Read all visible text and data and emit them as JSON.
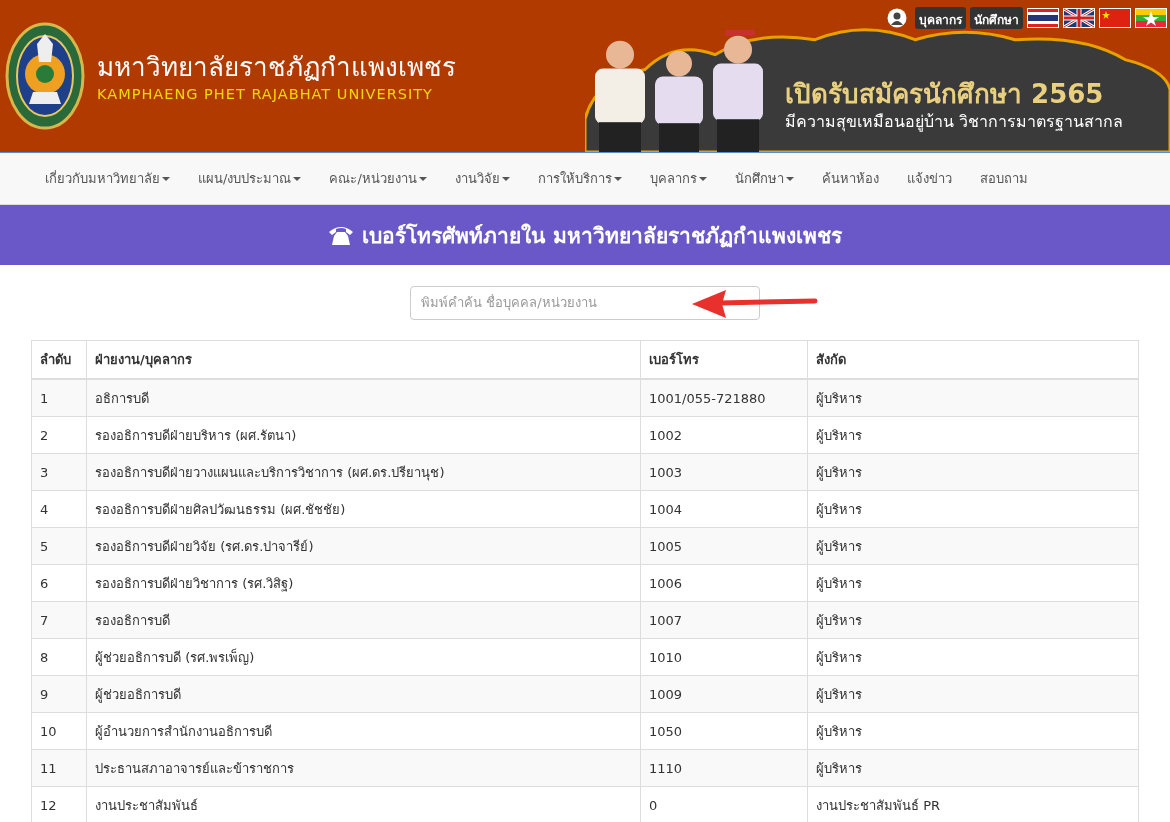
{
  "top_bar": {
    "buttons": [
      "บุคลากร",
      "นักศึกษา"
    ]
  },
  "header": {
    "title": "มหาวิทยาลัยราชภัฏกำแพงเพชร",
    "subtitle": "KAMPHAENG PHET RAJABHAT UNIVERSITY"
  },
  "banner": {
    "headline": "เปิดรับสมัครนักศึกษา 2565",
    "tagline": "มีความสุขเหมือนอยู่บ้าน  วิชาการมาตรฐานสากล"
  },
  "nav": [
    {
      "label": "เกี่ยวกับมหาวิทยาลัย",
      "dropdown": true
    },
    {
      "label": "แผน/งบประมาณ",
      "dropdown": true
    },
    {
      "label": "คณะ/หน่วยงาน",
      "dropdown": true
    },
    {
      "label": "งานวิจัย",
      "dropdown": true
    },
    {
      "label": "การให้บริการ",
      "dropdown": true
    },
    {
      "label": "บุคลากร",
      "dropdown": true
    },
    {
      "label": "นักศึกษา",
      "dropdown": true
    },
    {
      "label": "ค้นหาห้อง",
      "dropdown": false
    },
    {
      "label": "แจ้งข่าว",
      "dropdown": false
    },
    {
      "label": "สอบถาม",
      "dropdown": false
    }
  ],
  "page_title": "เบอร์โทรศัพท์ภายใน มหาวิทยาลัยราชภัฏกำแพงเพชร",
  "search": {
    "placeholder": "พิมพ์คำค้น ชื่อบุคคล/หน่วยงาน"
  },
  "table": {
    "columns": [
      "ลำดับ",
      "ฝ่ายงาน/บุคลากร",
      "เบอร์โทร",
      "สังกัด"
    ],
    "rows": [
      [
        "1",
        "อธิการบดี",
        "1001/055-721880",
        "ผู้บริหาร"
      ],
      [
        "2",
        "รองอธิการบดีฝ่ายบริหาร (ผศ.รัตนา)",
        "1002",
        "ผู้บริหาร"
      ],
      [
        "3",
        "รองอธิการบดีฝ่ายวางแผนและบริการวิชาการ  (ผศ.ดร.ปรียานุช)",
        "1003",
        "ผู้บริหาร"
      ],
      [
        "4",
        "รองอธิการบดีฝ่ายศิลปวัฒนธรรม (ผศ.ชัชชัย)",
        "1004",
        "ผู้บริหาร"
      ],
      [
        "5",
        "รองอธิการบดีฝ่ายวิจัย (รศ.ดร.ปาจารีย์)",
        "1005",
        "ผู้บริหาร"
      ],
      [
        "6",
        "รองอธิการบดีฝ่ายวิชาการ (รศ.วิสิฐ)",
        "1006",
        "ผู้บริหาร"
      ],
      [
        "7",
        "รองอธิการบดี",
        "1007",
        "ผู้บริหาร"
      ],
      [
        "8",
        "ผู้ช่วยอธิการบดี (รศ.พรเพ็ญ)",
        "1010",
        "ผู้บริหาร"
      ],
      [
        "9",
        "ผู้ช่วยอธิการบดี",
        "1009",
        "ผู้บริหาร"
      ],
      [
        "10",
        "ผู้อำนวยการสำนักงานอธิการบดี",
        "1050",
        "ผู้บริหาร"
      ],
      [
        "11",
        "ประธานสภาอาจารย์และข้าราชการ",
        "1110",
        "ผู้บริหาร"
      ],
      [
        "12",
        "งานประชาสัมพันธ์",
        "0",
        "งานประชาสัมพันธ์ PR"
      ]
    ]
  }
}
